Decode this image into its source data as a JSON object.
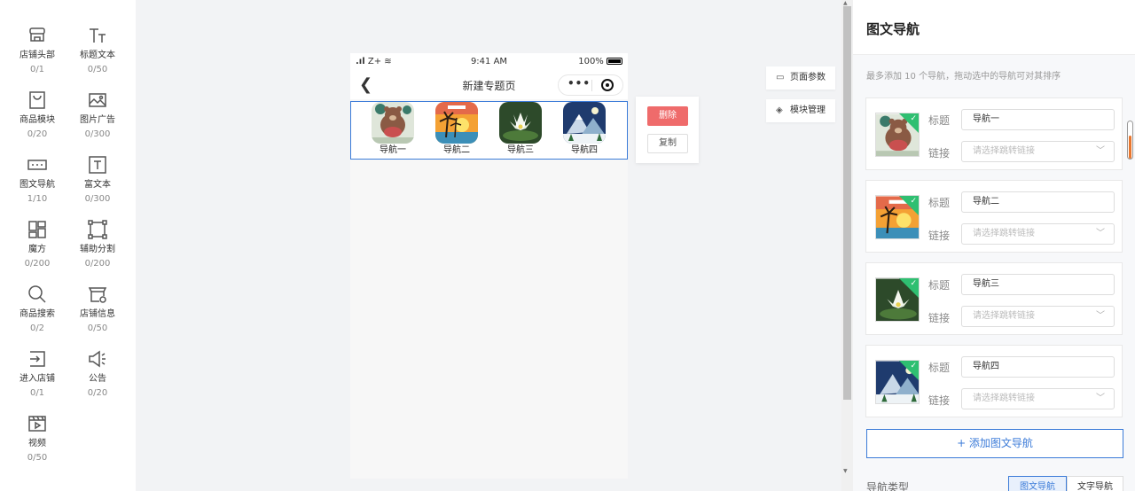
{
  "components": [
    {
      "name": "店铺头部",
      "count": "0/1",
      "icon": "shop-header-icon"
    },
    {
      "name": "标题文本",
      "count": "0/50",
      "icon": "title-text-icon"
    },
    {
      "name": "商品模块",
      "count": "0/20",
      "icon": "goods-module-icon"
    },
    {
      "name": "图片广告",
      "count": "0/300",
      "icon": "image-ad-icon"
    },
    {
      "name": "图文导航",
      "count": "1/10",
      "icon": "image-nav-icon"
    },
    {
      "name": "富文本",
      "count": "0/300",
      "icon": "rich-text-icon"
    },
    {
      "name": "魔方",
      "count": "0/200",
      "icon": "magic-cube-icon"
    },
    {
      "name": "辅助分割",
      "count": "0/200",
      "icon": "divider-icon"
    },
    {
      "name": "商品搜索",
      "count": "0/2",
      "icon": "search-icon"
    },
    {
      "name": "店铺信息",
      "count": "0/50",
      "icon": "shop-info-icon"
    },
    {
      "name": "进入店铺",
      "count": "0/1",
      "icon": "enter-shop-icon"
    },
    {
      "name": "公告",
      "count": "0/20",
      "icon": "notice-icon"
    },
    {
      "name": "视频",
      "count": "0/50",
      "icon": "video-icon"
    }
  ],
  "phone": {
    "status": {
      "signal": "Z+",
      "time": "9:41 AM",
      "battery": "100%"
    },
    "title": "新建专题页",
    "nav_items": [
      "导航一",
      "导航二",
      "导航三",
      "导航四"
    ]
  },
  "actions": {
    "delete": "删除",
    "copy": "复制"
  },
  "side_buttons": {
    "page_params": "页面参数",
    "module_manage": "模块管理"
  },
  "panel": {
    "title": "图文导航",
    "tip": "最多添加 10 个导航，拖动选中的导航可对其排序",
    "title_label": "标题",
    "link_label": "链接",
    "link_placeholder": "请选择跳转链接",
    "items": [
      {
        "title": "导航一"
      },
      {
        "title": "导航二"
      },
      {
        "title": "导航三"
      },
      {
        "title": "导航四"
      }
    ],
    "add_button": "+ 添加图文导航",
    "nav_type_label": "导航类型",
    "nav_type_options": [
      "图文导航",
      "文字导航"
    ],
    "nav_type_selected": "图文导航"
  },
  "colors": {
    "accent": "#3b7bd8",
    "danger": "#ef6b6b",
    "check": "#2fbf71"
  }
}
